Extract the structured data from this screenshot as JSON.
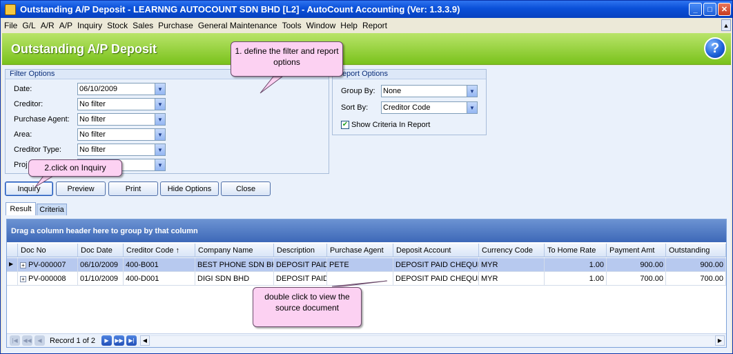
{
  "window": {
    "title": "Outstanding A/P Deposit  - LEARNNG AUTOCOUNT SDN BHD [L2] - AutoCount Accounting (Ver: 1.3.3.9)",
    "controls": [
      "_",
      "□",
      "✕"
    ]
  },
  "menu": [
    "File",
    "G/L",
    "A/R",
    "A/P",
    "Inquiry",
    "Stock",
    "Sales",
    "Purchase",
    "General Maintenance",
    "Tools",
    "Window",
    "Help",
    "Report"
  ],
  "header": {
    "title": "Outstanding A/P Deposit",
    "help": "?"
  },
  "filter": {
    "legend": "Filter Options",
    "fields": [
      {
        "label": "Date:",
        "value": "06/10/2009"
      },
      {
        "label": "Creditor:",
        "value": "No filter"
      },
      {
        "label": "Purchase Agent:",
        "value": "No filter"
      },
      {
        "label": "Area:",
        "value": "No filter"
      },
      {
        "label": "Creditor Type:",
        "value": "No filter"
      },
      {
        "label": "Proj",
        "value": ""
      }
    ]
  },
  "report": {
    "legend": "Report Options",
    "group_by_label": "Group By:",
    "group_by_value": "None",
    "sort_by_label": "Sort By:",
    "sort_by_value": "Creditor Code",
    "show_criteria_label": "Show Criteria In Report",
    "show_criteria_checked": true
  },
  "buttons": {
    "inquiry": "Inquiry",
    "preview": "Preview",
    "print": "Print",
    "hide_options": "Hide Options",
    "close": "Close"
  },
  "tabs": {
    "result": "Result",
    "criteria": "Criteria",
    "active": "Result"
  },
  "grid": {
    "group_hint": "Drag a column header here to group by that column",
    "columns": [
      "Doc No",
      "Doc Date",
      "Creditor Code",
      "Company Name",
      "Description",
      "Purchase Agent",
      "Deposit Account",
      "Currency Code",
      "To Home Rate",
      "Payment Amt",
      "Outstanding"
    ],
    "sort_indicator": "↑",
    "rows": [
      [
        "PV-000007",
        "06/10/2009",
        "400-B001",
        "BEST PHONE SDN BHD",
        "DEPOSIT PAID",
        "PETE",
        "DEPOSIT PAID CHEQUE",
        "MYR",
        "1.00",
        "900.00",
        "900.00"
      ],
      [
        "PV-000008",
        "01/10/2009",
        "400-D001",
        "DIGI SDN BHD",
        "DEPOSIT PAID",
        "",
        "DEPOSIT PAID CHEQUE",
        "MYR",
        "1.00",
        "700.00",
        "700.00"
      ]
    ],
    "selected_row": 0,
    "record_text": "Record 1 of 2"
  },
  "callouts": {
    "filter": "1. define the filter and report options",
    "inquiry": "2.click on Inquiry",
    "doubleclick": "double click to view the source document"
  }
}
